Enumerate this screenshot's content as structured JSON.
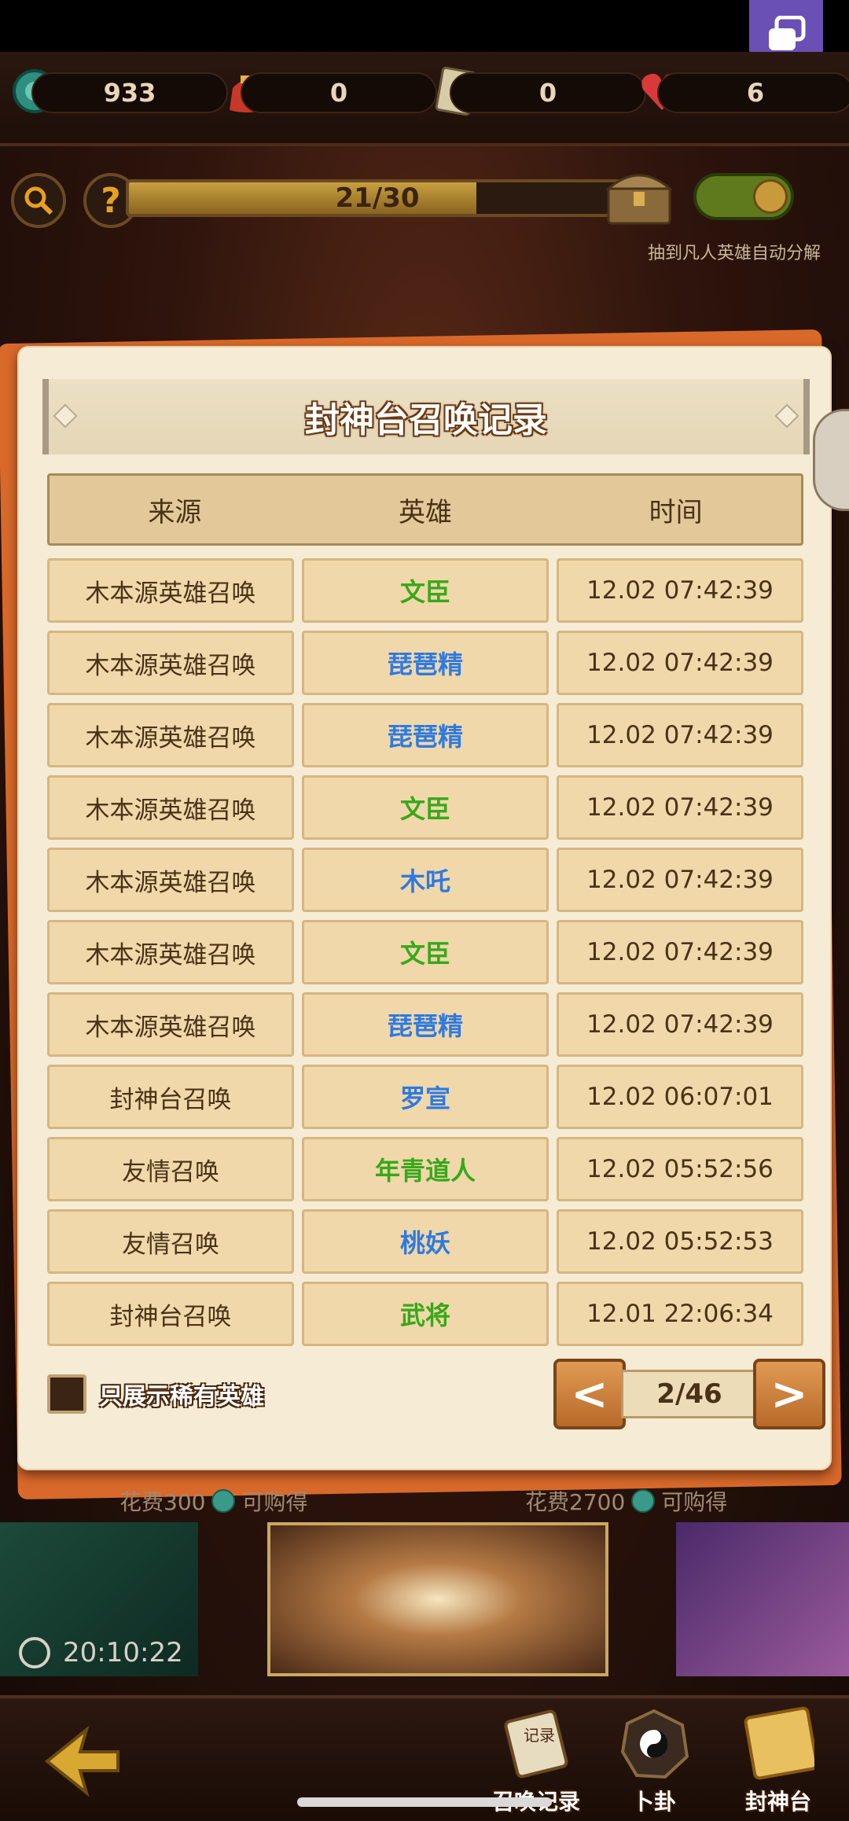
{
  "resources": [
    {
      "icon": "jade-coin-icon",
      "value": "933"
    },
    {
      "icon": "lucky-bag-icon",
      "value": "0"
    },
    {
      "icon": "ticket-icon",
      "value": "0",
      "icon_text": "券"
    },
    {
      "icon": "heart-icon",
      "value": "6"
    }
  ],
  "progress": {
    "text": "21/30",
    "value": 21,
    "max": 30
  },
  "auto_decompose_label": "抽到凡人英雄自动分解",
  "auto_decompose_on": true,
  "modal": {
    "title": "封神台召唤记录",
    "columns": [
      "来源",
      "英雄",
      "时间"
    ],
    "rows": [
      {
        "source": "木本源英雄召唤",
        "hero": "文臣",
        "hero_color": "#38a81a",
        "time": "12.02 07:42:39"
      },
      {
        "source": "木本源英雄召唤",
        "hero": "琵琶精",
        "hero_color": "#2e7ae0",
        "time": "12.02 07:42:39"
      },
      {
        "source": "木本源英雄召唤",
        "hero": "琵琶精",
        "hero_color": "#2e7ae0",
        "time": "12.02 07:42:39"
      },
      {
        "source": "木本源英雄召唤",
        "hero": "文臣",
        "hero_color": "#38a81a",
        "time": "12.02 07:42:39"
      },
      {
        "source": "木本源英雄召唤",
        "hero": "木吒",
        "hero_color": "#2e7ae0",
        "time": "12.02 07:42:39"
      },
      {
        "source": "木本源英雄召唤",
        "hero": "文臣",
        "hero_color": "#38a81a",
        "time": "12.02 07:42:39"
      },
      {
        "source": "木本源英雄召唤",
        "hero": "琵琶精",
        "hero_color": "#2e7ae0",
        "time": "12.02 07:42:39"
      },
      {
        "source": "封神台召唤",
        "hero": "罗宣",
        "hero_color": "#2e7ae0",
        "time": "12.02 06:07:01"
      },
      {
        "source": "友情召唤",
        "hero": "年青道人",
        "hero_color": "#38a81a",
        "time": "12.02 05:52:56"
      },
      {
        "source": "友情召唤",
        "hero": "桃妖",
        "hero_color": "#2e7ae0",
        "time": "12.02 05:52:53"
      },
      {
        "source": "封神台召唤",
        "hero": "武将",
        "hero_color": "#38a81a",
        "time": "12.01 22:06:34"
      }
    ],
    "rare_only_label": "只展示稀有英雄",
    "rare_only_checked": false,
    "pager": {
      "prev": "<",
      "next": ">",
      "page_text": "2/46"
    }
  },
  "shop": {
    "left_cost_label": "花费300",
    "left_suffix": "可购得",
    "right_cost_label": "花费2700",
    "right_suffix": "可购得",
    "timer": "20:10:22"
  },
  "nav": {
    "items": [
      {
        "label": "召唤记录",
        "icon": "record-scroll-icon",
        "icon_text": "记录"
      },
      {
        "label": "卜卦",
        "icon": "bagua-icon"
      },
      {
        "label": "封神台",
        "icon": "fengshen-scroll-icon"
      }
    ]
  },
  "colors": {
    "hero_green": "#38a81a",
    "hero_blue": "#2e7ae0",
    "accent_orange": "#d9692a"
  }
}
